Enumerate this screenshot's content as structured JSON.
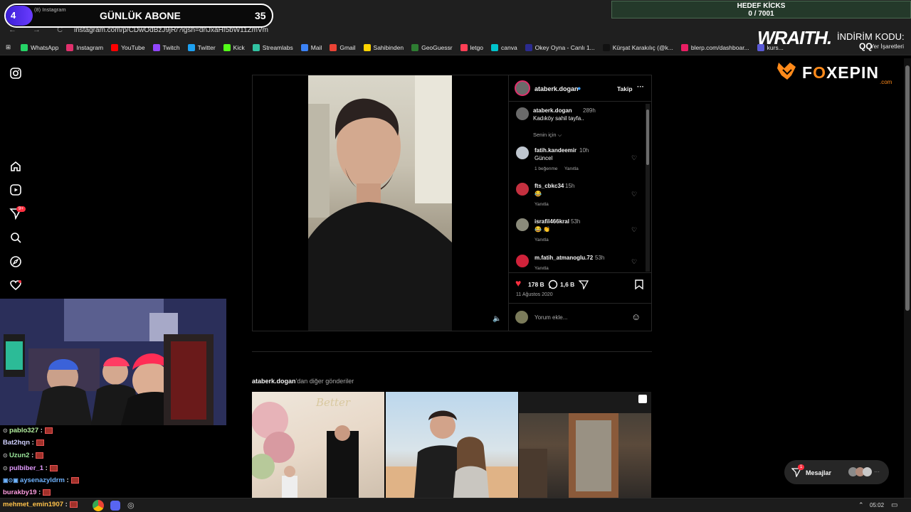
{
  "overlay": {
    "subs_number": "4",
    "tab_label": "(8) Instagram",
    "subs_title": "GÜNLÜK ABONE",
    "subs_count": "35",
    "goal_title": "HEDEF KİCKS",
    "goal_value": "0 / 7001",
    "sponsor1": "WRAITH.",
    "discount_label": "İNDİRİM KODU:",
    "discount_code": "QQ",
    "sponsor2_a": "F",
    "sponsor2_b": "O",
    "sponsor2_c": "XEPIN",
    "sponsor2_domain": ".com"
  },
  "browser": {
    "url": "instagram.com/p/CDwOdBzJ9jR/?igsh=dnJxaHI5bW11ZmVm",
    "nav_icons": "← → C",
    "bookmarks": [
      "WhatsApp",
      "Instagram",
      "YouTube",
      "Twitch",
      "Twitter",
      "Kick",
      "Streamlabs",
      "Mail",
      "Gmail",
      "Sahibinden",
      "GeoGuessr",
      "letgo",
      "canva",
      "Okey Oyna - Canlı 1...",
      "Kürşat Karakılıç (@k...",
      "blerp.com/dashboar...",
      "kurs..."
    ],
    "bookmark_colors": [
      "#25d366",
      "#e1306c",
      "#ff0000",
      "#9146ff",
      "#1da1f2",
      "#53fc18",
      "#31c3a2",
      "#3b82f6",
      "#ea4335",
      "#ffd400",
      "#2e7d32",
      "#ff3f55",
      "#00c4cc",
      "#2b2b8f",
      "#111111",
      "#e91e63",
      "#5a5ad6"
    ],
    "bookmarks_right": "Yer İşaretleri"
  },
  "post": {
    "username": "ataberk.dogan",
    "follow": "Takip",
    "more": "···",
    "caption_user": "ataberk.dogan",
    "caption_age": "289h",
    "caption_text": "Kadıköy sahil tayfa..",
    "sort": "Senin için",
    "comments": [
      {
        "user": "fatih.kandeemir",
        "age": "10h",
        "text": "Güncel",
        "meta1": "1 beğenme",
        "meta2": "Yanıtla"
      },
      {
        "user": "fts_cbkc34",
        "age": "15h",
        "text": "😂",
        "meta1": "Yanıtla",
        "meta2": ""
      },
      {
        "user": "israfil466kral",
        "age": "53h",
        "text": "😂 👏",
        "meta1": "Yanıtla",
        "meta2": ""
      },
      {
        "user": "m.fatih_atmanoglu.72",
        "age": "53h",
        "text": "",
        "meta1": "Yanıtla",
        "meta2": ""
      }
    ],
    "likes": "178 B",
    "comments_count": "1,6 B",
    "date": "11 Ağustos 2020",
    "add_comment": "Yorum ekle..."
  },
  "more_posts": {
    "user": "ataberk.dogan",
    "suffix": "'dan diğer gönderiler"
  },
  "chat": [
    {
      "user": "pablo327",
      "color": "#b4f0a0"
    },
    {
      "user": "Bat2hqn",
      "color": "#d0d0ff"
    },
    {
      "user": "Uzun2",
      "color": "#9be69b"
    },
    {
      "user": "pulbiber_1",
      "color": "#e39bff"
    },
    {
      "user": "aysenazyldrm",
      "color": "#6fb3ff"
    },
    {
      "user": "burakby19",
      "color": "#ff9de0"
    },
    {
      "user": "mehmet_emin1907",
      "color": "#ffc24a"
    }
  ],
  "messages": {
    "label": "Mesajlar",
    "badge": "1"
  },
  "taskbar": {
    "time": "05:02"
  }
}
